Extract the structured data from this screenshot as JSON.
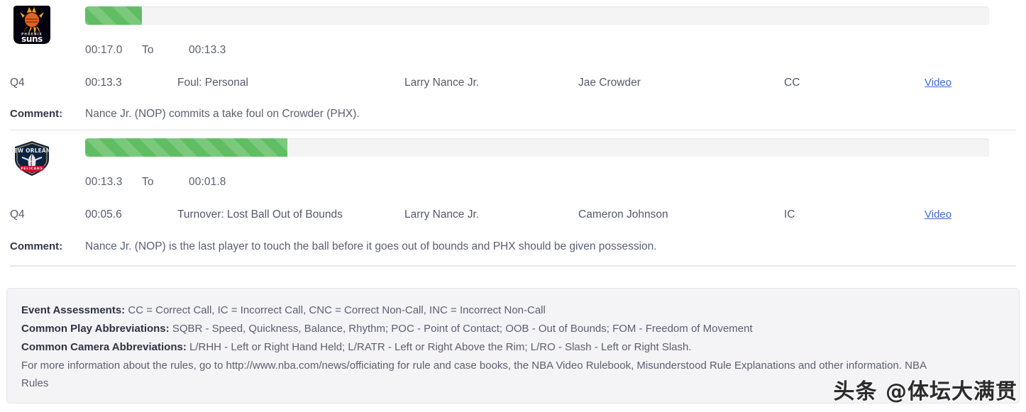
{
  "plays": [
    {
      "team_logo": "phoenix-suns-logo",
      "team_name": "Phoenix Suns",
      "progress_percent": 6.3,
      "period_start": "00:17.0",
      "to_label": "To",
      "period_end": "00:13.3",
      "event": {
        "period": "Q4",
        "time": "00:13.3",
        "call_type": "Foul: Personal",
        "committed_by": "Larry Nance Jr.",
        "disadvantaged_by": "Jae Crowder",
        "assessment": "CC",
        "video_label": "Video"
      },
      "comment_label": "Comment:",
      "comment_text": "Nance Jr. (NOP) commits a take foul on Crowder (PHX)."
    },
    {
      "team_logo": "new-orleans-pelicans-logo",
      "team_name": "New Orleans Pelicans",
      "progress_percent": 22.4,
      "period_start": "00:13.3",
      "to_label": "To",
      "period_end": "00:01.8",
      "event": {
        "period": "Q4",
        "time": "00:05.6",
        "call_type": "Turnover: Lost Ball Out of Bounds",
        "committed_by": "Larry Nance Jr.",
        "disadvantaged_by": "Cameron Johnson",
        "assessment": "IC",
        "video_label": "Video"
      },
      "comment_label": "Comment:",
      "comment_text": "Nance Jr. (NOP) is the last player to touch the ball before it goes out of bounds and PHX should be given possession."
    }
  ],
  "legend": {
    "event_assessments_label": "Event Assessments:",
    "event_assessments_text": "CC = Correct Call, IC = Incorrect Call, CNC = Correct Non-Call, INC = Incorrect Non-Call",
    "play_abbrev_label": "Common Play Abbreviations:",
    "play_abbrev_text": "SQBR - Speed, Quickness, Balance, Rhythm; POC - Point of Contact; OOB - Out of Bounds; FOM - Freedom of Movement",
    "camera_abbrev_label": "Common Camera Abbreviations:",
    "camera_abbrev_text": "L/RHH - Left or Right Hand Held; L/RATR - Left or Right Above the Rim; L/RO - Slash - Left or Right Slash.",
    "more_info_text": "For more information about the rules, go to http://www.nba.com/news/officiating for rule and case books, the NBA Video Rulebook, Misunderstood Rule Explanations and other information. NBA Rules"
  },
  "watermark": {
    "text": "头条 @体坛大满贯"
  },
  "colors": {
    "progress_fill": "#61bd63",
    "progress_track": "#f4f4f6",
    "link": "#3f6ad8",
    "text": "#5b5f72",
    "legend_bg": "#f4f4f6"
  }
}
